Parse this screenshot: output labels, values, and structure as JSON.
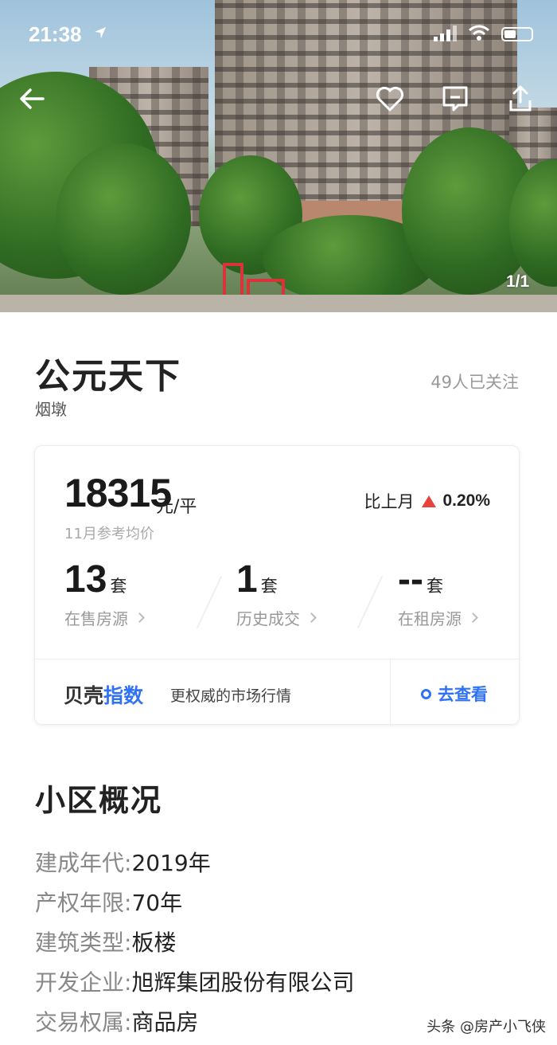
{
  "status_bar": {
    "time": "21:38"
  },
  "gallery": {
    "counter": "1/1"
  },
  "community": {
    "name": "公元天下",
    "district": "烟墩",
    "followers": "49人已关注"
  },
  "price_card": {
    "price": "18315",
    "price_unit": "元/平",
    "price_label": "11月参考均价",
    "mom_label": "比上月",
    "mom_value": "0.20%",
    "mom_direction": "up",
    "stats": [
      {
        "value": "13",
        "unit": "套",
        "label": "在售房源"
      },
      {
        "value": "1",
        "unit": "套",
        "label": "历史成交"
      },
      {
        "value": "--",
        "unit": "套",
        "label": "在租房源"
      }
    ],
    "footer": {
      "brand_a": "贝壳",
      "brand_b": "指数",
      "subtitle": "更权威的市场行情",
      "action": "去查看"
    }
  },
  "overview": {
    "title": "小区概况",
    "rows": [
      {
        "key": "建成年代:",
        "value": "2019年"
      },
      {
        "key": "产权年限:",
        "value": "70年"
      },
      {
        "key": "建筑类型:",
        "value": "板楼"
      },
      {
        "key": "开发企业:",
        "value": "旭辉集团股份有限公司"
      },
      {
        "key": "交易权属:",
        "value": "商品房"
      }
    ]
  },
  "watermark": "头条 @房产小飞侠",
  "colors": {
    "accent_blue": "#3072f6",
    "up_red": "#e8423c"
  }
}
